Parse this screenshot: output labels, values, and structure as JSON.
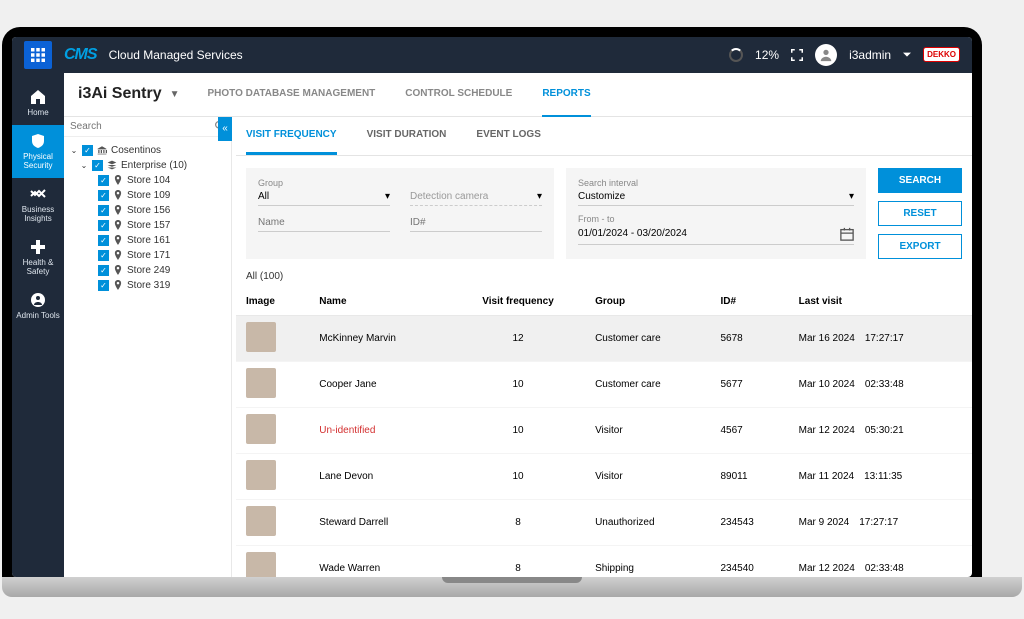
{
  "top": {
    "brand": "CMS",
    "subtitle": "Cloud Managed Services",
    "progress_pct": "12%",
    "username": "i3admin",
    "badge": "DEKKO"
  },
  "iconbar": [
    {
      "label": "Home"
    },
    {
      "label": "Physical Security"
    },
    {
      "label": "Business Insights"
    },
    {
      "label": "Health & Safety"
    },
    {
      "label": "Admin Tools"
    }
  ],
  "subheader": {
    "title": "i3Ai Sentry",
    "nav": [
      "PHOTO DATABASE MANAGEMENT",
      "CONTROL SCHEDULE",
      "REPORTS"
    ],
    "active": 2
  },
  "tree": {
    "search_placeholder": "Search",
    "root": "Cosentinos",
    "group": "Enterprise (10)",
    "stores": [
      "Store 104",
      "Store 109",
      "Store 156",
      "Store 157",
      "Store 161",
      "Store 171",
      "Store 249",
      "Store 319"
    ]
  },
  "tabs": {
    "items": [
      "VISIT FREQUENCY",
      "VISIT DURATION",
      "EVENT LOGS"
    ],
    "active": 0
  },
  "filters": {
    "group_label": "Group",
    "group_value": "All",
    "camera_label": "Detection camera",
    "name_label": "Name",
    "id_label": "ID#",
    "interval_label": "Search interval",
    "interval_value": "Customize",
    "range_label": "From - to",
    "range_value": "01/01/2024 - 03/20/2024"
  },
  "actions": {
    "search": "SEARCH",
    "reset": "RESET",
    "export": "EXPORT"
  },
  "count": "All (100)",
  "columns": [
    "Image",
    "Name",
    "Visit frequency",
    "Group",
    "ID#",
    "Last visit"
  ],
  "rows": [
    {
      "name": "McKinney Marvin",
      "freq": "12",
      "group": "Customer care",
      "id": "5678",
      "date": "Mar 16 2024",
      "time": "17:27:17",
      "hl": true
    },
    {
      "name": "Cooper Jane",
      "freq": "10",
      "group": "Customer care",
      "id": "5677",
      "date": "Mar 10 2024",
      "time": "02:33:48"
    },
    {
      "name": "Un-identified",
      "freq": "10",
      "group": "Visitor",
      "id": "4567",
      "date": "Mar 12 2024",
      "time": "05:30:21",
      "red": true
    },
    {
      "name": "Lane Devon",
      "freq": "10",
      "group": "Visitor",
      "id": "89011",
      "date": "Mar 11 2024",
      "time": "13:11:35"
    },
    {
      "name": "Steward Darrell",
      "freq": "8",
      "group": "Unauthorized",
      "id": "234543",
      "date": "Mar 9 2024",
      "time": "17:27:17"
    },
    {
      "name": "Wade Warren",
      "freq": "8",
      "group": "Shipping",
      "id": "234540",
      "date": "Mar 12 2024",
      "time": "02:33:48"
    }
  ]
}
